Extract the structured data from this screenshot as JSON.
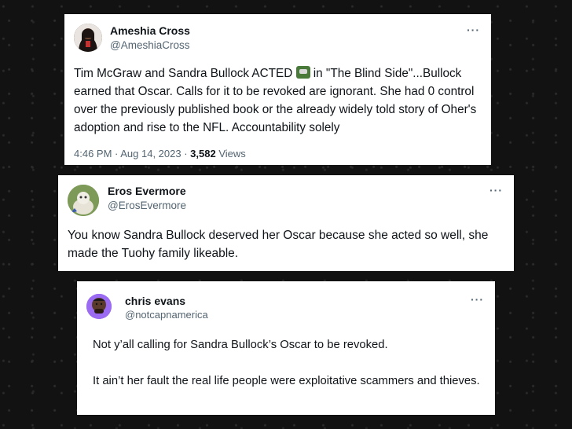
{
  "tweets": [
    {
      "name": "Ameshia Cross",
      "handle": "@AmeshiaCross",
      "more": "···",
      "text_before_emoji": "Tim McGraw and Sandra Bullock ACTED ",
      "emoji_icon": "movie-clapper-icon",
      "text_after_emoji": " in \"The Blind Side\"...Bullock earned that Oscar. Calls for it to be revoked are ignorant. She had 0 control over the previously published book or the already widely told story of Oher's adoption and rise to the NFL. Accountability solely",
      "time": "4:46 PM · Aug 14, 2023 · ",
      "views_count": "3,582",
      "views_label": " Views"
    },
    {
      "name": "Eros Evermore",
      "handle": "@ErosEvermore",
      "more": "···",
      "text": "You know Sandra Bullock deserved her Oscar because she acted so well, she made the Tuohy family likeable."
    },
    {
      "name": "chris evans",
      "handle": "@notcapnamerica",
      "more": "···",
      "paragraph1": "Not y’all calling for Sandra Bullock’s Oscar to be revoked.",
      "paragraph2": "It ain’t her fault the real life people were exploitative scammers and thieves."
    }
  ],
  "colors": {
    "background": "#121212",
    "card": "#ffffff",
    "primary_text": "#0f1419",
    "secondary_text": "#536471"
  }
}
